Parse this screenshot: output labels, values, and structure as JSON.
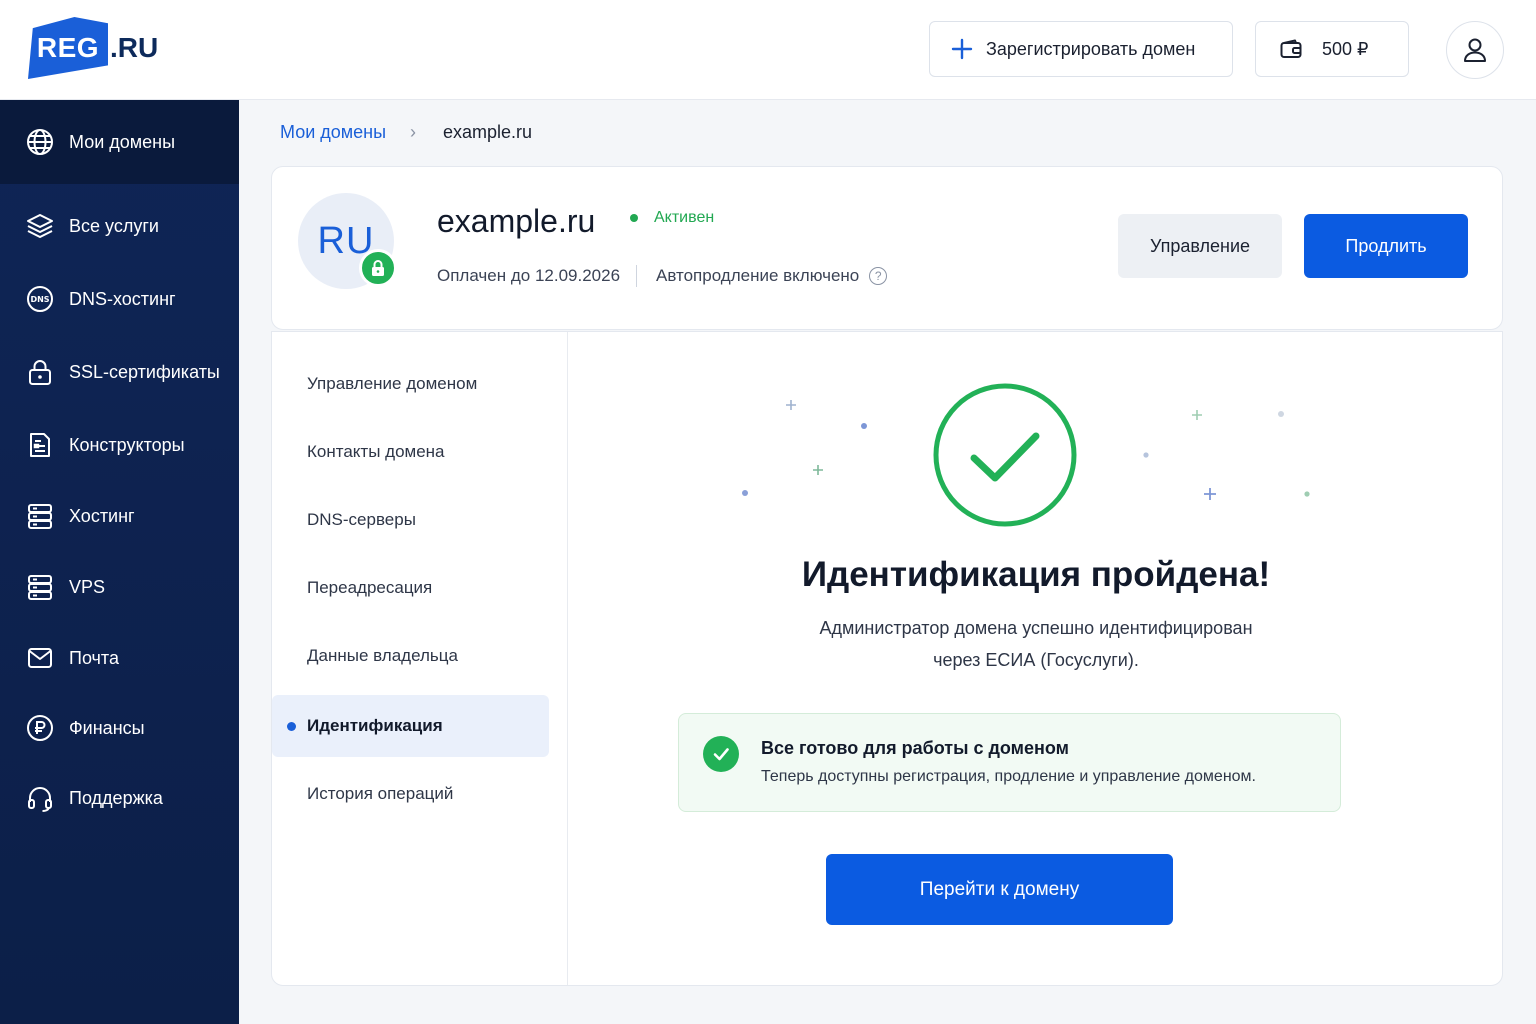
{
  "header": {
    "logo_main": "REG",
    "logo_tail": ".RU",
    "register_label": "Зарегистрировать домен",
    "balance": "500 ₽"
  },
  "sidebar": {
    "items": [
      {
        "label": "Мои домены",
        "icon": "globe-icon",
        "active": true
      },
      {
        "label": "Все услуги",
        "icon": "layers-icon"
      },
      {
        "label": "DNS-хостинг",
        "icon": "dns-icon"
      },
      {
        "label": "SSL-сертификаты",
        "icon": "lock-icon"
      },
      {
        "label": "Конструкторы",
        "icon": "document-icon"
      },
      {
        "label": "Хостинг",
        "icon": "server-icon"
      },
      {
        "label": "VPS",
        "icon": "server-icon"
      },
      {
        "label": "Почта",
        "icon": "mail-icon"
      },
      {
        "label": "Финансы",
        "icon": "ruble-icon"
      },
      {
        "label": "Поддержка",
        "icon": "headset-icon"
      }
    ]
  },
  "breadcrumb": {
    "link": "Мои домены",
    "separator": "›",
    "current": "example.ru"
  },
  "domain": {
    "zone": "RU",
    "name": "example.ru",
    "status": "Активен",
    "paid_until": "Оплачен до 12.09.2026",
    "autorenew": "Автопродление включено",
    "help": "?",
    "manage_label": "Управление",
    "renew_label": "Продлить"
  },
  "submenu": {
    "items": [
      {
        "label": "Управление доменом"
      },
      {
        "label": "Контакты домена"
      },
      {
        "label": "DNS-серверы"
      },
      {
        "label": "Переадресация"
      },
      {
        "label": "Данные владельца"
      },
      {
        "label": "Идентификация",
        "active": true
      },
      {
        "label": "История операций"
      }
    ]
  },
  "result": {
    "title": "Идентификация пройдена!",
    "desc_line1": "Администратор домена успешно идентифицирован",
    "desc_line2": "через ЕСИА (Госуслуги).",
    "ready_title": "Все готово для работы с доменом",
    "ready_text": "Теперь доступны регистрация, продление и управление доменом.",
    "go_label": "Перейти к домену"
  },
  "colors": {
    "brand_blue": "#0b5be1",
    "sidebar_bg": "#0f2350",
    "success_green": "#22b157"
  }
}
